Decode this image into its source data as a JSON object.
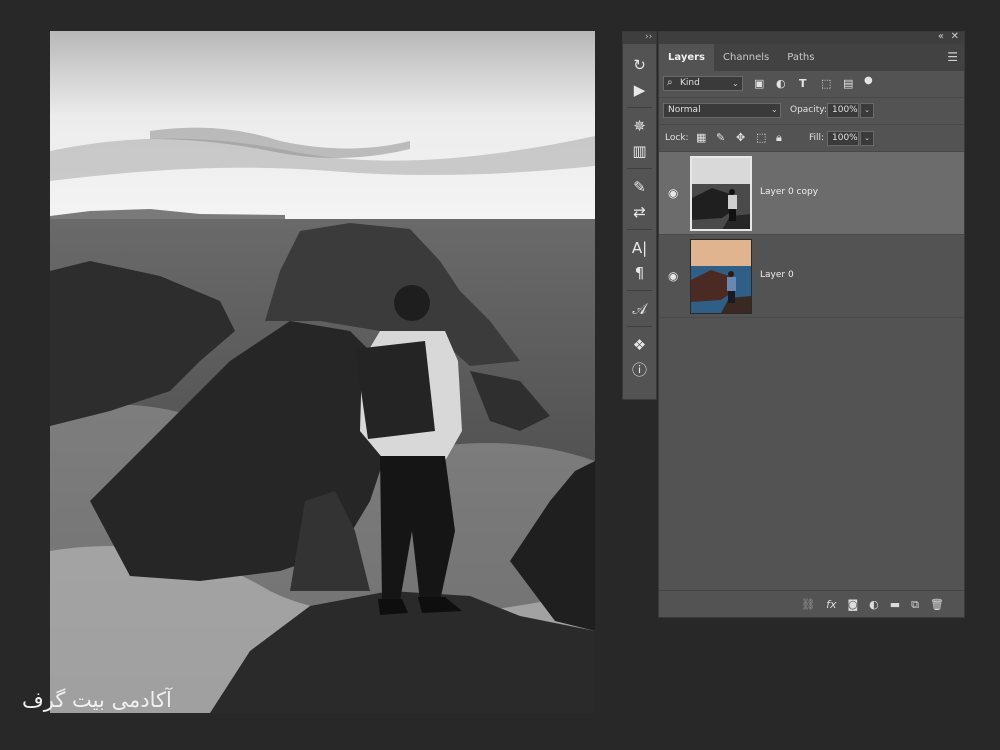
{
  "watermark": "آکادمی بیت گرف",
  "tools_panel": {
    "collapse_label": "››",
    "tools": [
      {
        "name": "history-brush-icon",
        "glyph": "↻"
      },
      {
        "name": "play-actions-icon",
        "glyph": "▶"
      },
      {
        "name": "compass-wheel-icon",
        "glyph": "✵"
      },
      {
        "name": "histogram-icon",
        "glyph": "▥"
      },
      {
        "name": "brush-settings-icon",
        "glyph": "✎"
      },
      {
        "name": "adjustment-sliders-icon",
        "glyph": "⇄"
      },
      {
        "name": "character-text-icon",
        "glyph": "A|"
      },
      {
        "name": "paragraph-icon",
        "glyph": "¶"
      },
      {
        "name": "glyphs-icon",
        "glyph": "𝒜"
      },
      {
        "name": "3d-cube-icon",
        "glyph": "❖"
      },
      {
        "name": "info-icon",
        "glyph": "ⓘ"
      }
    ]
  },
  "layers_panel": {
    "titlebar": {
      "collapse": "«",
      "close": "✕"
    },
    "tabs": [
      {
        "label": "Layers",
        "active": true
      },
      {
        "label": "Channels",
        "active": false
      },
      {
        "label": "Paths",
        "active": false
      }
    ],
    "filter": {
      "icon": "search-icon",
      "value": "Kind"
    },
    "filter_icons": [
      "image-filter-icon",
      "adjustment-filter-icon",
      "type-filter-icon",
      "shape-filter-icon",
      "smart-object-filter-icon",
      "filter-toggle-icon"
    ],
    "blend_mode": "Normal",
    "opacity_label": "Opacity:",
    "opacity_value": "100%",
    "lock_label": "Lock:",
    "fill_label": "Fill:",
    "fill_value": "100%",
    "layers": [
      {
        "name": "Layer 0 copy",
        "selected": true,
        "visible": true,
        "thumb": "grayscale"
      },
      {
        "name": "Layer 0",
        "selected": false,
        "visible": true,
        "thumb": "color"
      }
    ],
    "bottom_icons": [
      "link-layers-icon",
      "fx-icon",
      "add-mask-icon",
      "adjustment-layer-icon",
      "group-folder-icon",
      "new-layer-icon",
      "delete-layer-icon"
    ]
  }
}
